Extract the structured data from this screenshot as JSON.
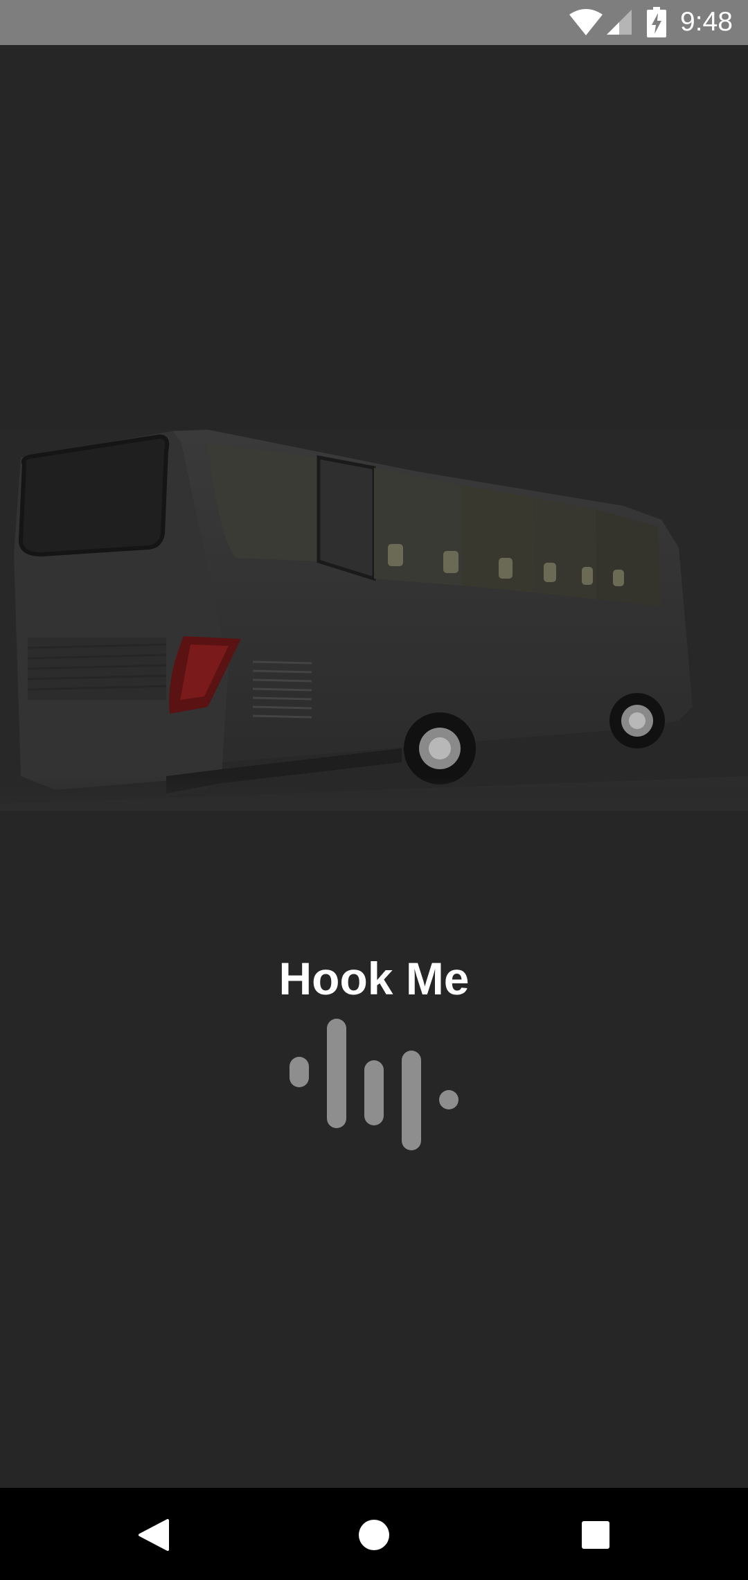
{
  "status_bar": {
    "time": "9:48",
    "icons": [
      "wifi-icon",
      "cell-signal-icon",
      "battery-charging-icon"
    ]
  },
  "splash": {
    "app_title": "Hook Me",
    "hero_image": "bus-rear-three-quarter-view",
    "loader_icon": "audio-wave-loader-icon"
  },
  "nav_bar": {
    "buttons": [
      "back-icon",
      "home-icon",
      "recents-icon"
    ]
  },
  "colors": {
    "background": "#262626",
    "status_bar": "#7e7e7e",
    "loader_bars": "#8e8e8e",
    "nav_bar": "#000000",
    "title_text": "#ffffff"
  }
}
